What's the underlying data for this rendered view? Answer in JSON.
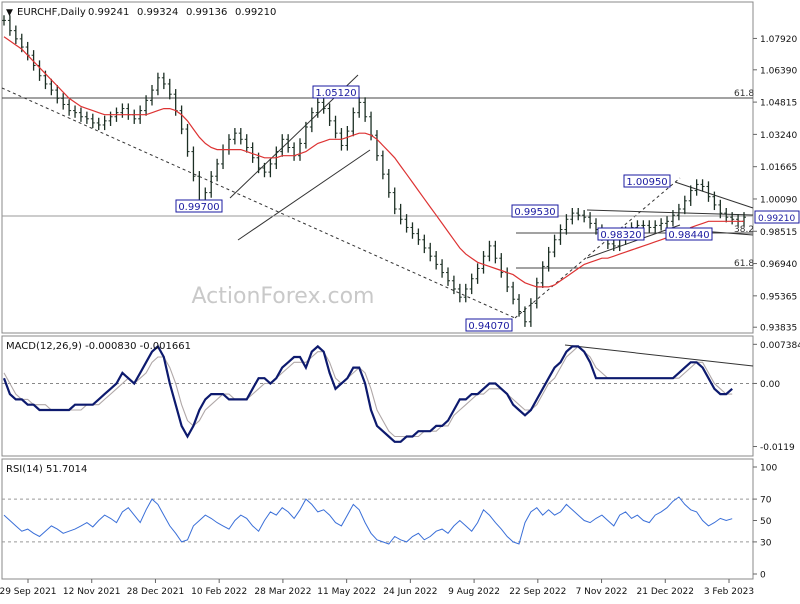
{
  "chart_data": [
    {
      "type": "line",
      "panel": "price",
      "header": {
        "arrow": "▼",
        "symbol": "EURCHF,Daily",
        "open": "0.99241",
        "high": "0.99324",
        "low": "0.99136",
        "close": "0.99210"
      },
      "watermark": "ActionForex.com",
      "ylim": [
        0.9365,
        1.096
      ],
      "y_ticks": [
        "1.07920",
        "1.06390",
        "1.04815",
        "1.03240",
        "1.01665",
        "1.00090",
        "0.98515",
        "0.96940",
        "0.95365",
        "0.93835"
      ],
      "current_price_label": "0.99210",
      "current_price": 0.9921,
      "x_labels": [
        "29 Sep 2021",
        "12 Nov 2021",
        "28 Dec 2021",
        "10 Feb 2022",
        "28 Mar 2022",
        "11 May 2022",
        "24 Jun 2022",
        "9 Aug 2022",
        "22 Sep 2022",
        "7 Nov 2022",
        "21 Dec 2022",
        "3 Feb 2023"
      ],
      "series": [
        {
          "style": "bars",
          "values": [
            1.088,
            1.083,
            1.079,
            1.075,
            1.071,
            1.066,
            1.061,
            1.057,
            1.054,
            1.05,
            1.047,
            1.044,
            1.043,
            1.041,
            1.04,
            1.038,
            1.037,
            1.039,
            1.041,
            1.043,
            1.045,
            1.042,
            1.04,
            1.044,
            1.049,
            1.054,
            1.06,
            1.057,
            1.052,
            1.044,
            1.035,
            1.024,
            1.012,
            1.0,
            1.004,
            1.012,
            1.018,
            1.025,
            1.03,
            1.033,
            1.03,
            1.026,
            1.021,
            1.016,
            1.014,
            1.018,
            1.024,
            1.03,
            1.026,
            1.022,
            1.028,
            1.036,
            1.043,
            1.048,
            1.045,
            1.039,
            1.033,
            1.027,
            1.034,
            1.043,
            1.048,
            1.041,
            1.032,
            1.022,
            1.013,
            1.004,
            0.996,
            0.991,
            0.987,
            0.984,
            0.981,
            0.977,
            0.973,
            0.969,
            0.965,
            0.961,
            0.957,
            0.953,
            0.957,
            0.962,
            0.967,
            0.973,
            0.978,
            0.972,
            0.965,
            0.958,
            0.952,
            0.946,
            0.941,
            0.95,
            0.96,
            0.968,
            0.975,
            0.981,
            0.986,
            0.991,
            0.994,
            0.993,
            0.992,
            0.989,
            0.986,
            0.983,
            0.979,
            0.978,
            0.981,
            0.985,
            0.987,
            0.988,
            0.988,
            0.987,
            0.988,
            0.989,
            0.99,
            0.993,
            0.996,
            1.0,
            1.005,
            1.008,
            1.007,
            1.002,
            0.998,
            0.994,
            0.992,
            0.991,
            0.99,
            0.992
          ]
        },
        {
          "style": "moving-average",
          "color": "#dd3333",
          "values": [
            1.08,
            1.078,
            1.076,
            1.074,
            1.071,
            1.068,
            1.065,
            1.062,
            1.059,
            1.056,
            1.053,
            1.05,
            1.048,
            1.046,
            1.045,
            1.044,
            1.043,
            1.042,
            1.042,
            1.042,
            1.042,
            1.042,
            1.042,
            1.042,
            1.042,
            1.043,
            1.044,
            1.045,
            1.045,
            1.044,
            1.042,
            1.039,
            1.035,
            1.031,
            1.028,
            1.026,
            1.025,
            1.025,
            1.025,
            1.025,
            1.025,
            1.024,
            1.023,
            1.022,
            1.021,
            1.021,
            1.021,
            1.022,
            1.022,
            1.022,
            1.023,
            1.024,
            1.026,
            1.028,
            1.029,
            1.03,
            1.03,
            1.03,
            1.031,
            1.032,
            1.033,
            1.033,
            1.032,
            1.03,
            1.027,
            1.024,
            1.021,
            1.017,
            1.013,
            1.009,
            1.005,
            1.001,
            0.997,
            0.993,
            0.989,
            0.985,
            0.981,
            0.977,
            0.974,
            0.972,
            0.97,
            0.969,
            0.968,
            0.967,
            0.966,
            0.965,
            0.964,
            0.962,
            0.96,
            0.959,
            0.958,
            0.958,
            0.958,
            0.959,
            0.961,
            0.963,
            0.965,
            0.967,
            0.969,
            0.97,
            0.971,
            0.972,
            0.972,
            0.973,
            0.974,
            0.975,
            0.976,
            0.977,
            0.978,
            0.979,
            0.98,
            0.981,
            0.982,
            0.983,
            0.984,
            0.985,
            0.987,
            0.988,
            0.989,
            0.99,
            0.99,
            0.99,
            0.99,
            0.99,
            0.99,
            0.99
          ]
        }
      ],
      "annotations": [
        {
          "label": "1.05120",
          "value": 1.0512
        },
        {
          "label": "0.99700",
          "value": 0.997
        },
        {
          "label": "0.99530",
          "value": 0.9953
        },
        {
          "label": "1.00950",
          "value": 1.0095
        },
        {
          "label": "0.98320",
          "value": 0.9832
        },
        {
          "label": "0.98440",
          "value": 0.9844
        },
        {
          "label": "0.94070",
          "value": 0.9407
        },
        {
          "label": "61.8",
          "value": 1.049
        },
        {
          "label": "61.8",
          "value": 0.969
        },
        {
          "label": "38.2",
          "value": 0.985
        }
      ]
    },
    {
      "type": "line",
      "panel": "macd",
      "title": "MACD(12,26,9) -0.000830 -0.001661",
      "ylim": [
        -0.0135,
        0.0082
      ],
      "y_ticks": [
        "0.007384",
        "0.00",
        "-0.0119"
      ],
      "series": [
        {
          "name": "MACD",
          "color": "#0d1a6e",
          "values": [
            0.001,
            -0.002,
            -0.003,
            -0.003,
            -0.004,
            -0.004,
            -0.005,
            -0.005,
            -0.005,
            -0.005,
            -0.005,
            -0.005,
            -0.004,
            -0.004,
            -0.004,
            -0.004,
            -0.003,
            -0.002,
            -0.001,
            0.0,
            0.002,
            0.001,
            0.0,
            0.002,
            0.004,
            0.006,
            0.007,
            0.005,
            0.0,
            -0.004,
            -0.008,
            -0.01,
            -0.008,
            -0.005,
            -0.003,
            -0.002,
            -0.002,
            -0.002,
            -0.003,
            -0.003,
            -0.003,
            -0.003,
            -0.001,
            0.001,
            0.001,
            0.0,
            0.001,
            0.003,
            0.004,
            0.005,
            0.005,
            0.003,
            0.006,
            0.007,
            0.006,
            0.002,
            -0.001,
            0.0,
            0.001,
            0.003,
            0.003,
            0.0,
            -0.005,
            -0.008,
            -0.009,
            -0.01,
            -0.011,
            -0.011,
            -0.01,
            -0.01,
            -0.009,
            -0.009,
            -0.009,
            -0.008,
            -0.008,
            -0.007,
            -0.005,
            -0.003,
            -0.003,
            -0.002,
            -0.002,
            -0.001,
            0.0,
            0.0,
            -0.001,
            -0.002,
            -0.004,
            -0.005,
            -0.006,
            -0.005,
            -0.003,
            -0.001,
            0.001,
            0.003,
            0.004,
            0.006,
            0.007,
            0.007,
            0.006,
            0.004,
            0.001,
            0.001,
            0.001,
            0.001,
            0.001,
            0.001,
            0.001,
            0.001,
            0.001,
            0.001,
            0.001,
            0.001,
            0.001,
            0.001,
            0.002,
            0.003,
            0.004,
            0.004,
            0.003,
            0.001,
            -0.001,
            -0.002,
            -0.002,
            -0.001
          ]
        },
        {
          "name": "Signal",
          "color": "#b0a8a8",
          "values": [
            0.002,
            0.0,
            -0.002,
            -0.003,
            -0.003,
            -0.004,
            -0.004,
            -0.004,
            -0.005,
            -0.005,
            -0.005,
            -0.005,
            -0.005,
            -0.005,
            -0.004,
            -0.004,
            -0.004,
            -0.003,
            -0.002,
            -0.001,
            0.0,
            0.001,
            0.0,
            0.001,
            0.002,
            0.004,
            0.005,
            0.005,
            0.003,
            0.0,
            -0.004,
            -0.007,
            -0.008,
            -0.007,
            -0.005,
            -0.004,
            -0.003,
            -0.002,
            -0.002,
            -0.003,
            -0.003,
            -0.003,
            -0.002,
            -0.001,
            0.0,
            0.0,
            0.001,
            0.002,
            0.003,
            0.004,
            0.004,
            0.004,
            0.005,
            0.006,
            0.006,
            0.004,
            0.001,
            0.0,
            0.001,
            0.002,
            0.003,
            0.002,
            -0.001,
            -0.005,
            -0.007,
            -0.009,
            -0.01,
            -0.01,
            -0.01,
            -0.01,
            -0.01,
            -0.009,
            -0.009,
            -0.009,
            -0.008,
            -0.008,
            -0.006,
            -0.005,
            -0.004,
            -0.003,
            -0.002,
            -0.002,
            -0.001,
            -0.001,
            -0.001,
            -0.002,
            -0.003,
            -0.004,
            -0.005,
            -0.005,
            -0.004,
            -0.002,
            0.0,
            0.001,
            0.003,
            0.005,
            0.006,
            0.007,
            0.006,
            0.005,
            0.003,
            0.002,
            0.001,
            0.001,
            0.001,
            0.001,
            0.001,
            0.001,
            0.001,
            0.001,
            0.001,
            0.001,
            0.001,
            0.001,
            0.001,
            0.002,
            0.003,
            0.004,
            0.004,
            0.002,
            0.0,
            -0.001,
            -0.002,
            -0.002
          ]
        }
      ]
    },
    {
      "type": "line",
      "panel": "rsi",
      "title": "RSI(14) 51.7014",
      "ylim": [
        0,
        100
      ],
      "y_ticks": [
        "100",
        "70",
        "50",
        "30",
        "0"
      ],
      "levels": [
        70,
        30
      ],
      "series": [
        {
          "name": "RSI",
          "color": "#3a6fd8",
          "values": [
            55,
            50,
            45,
            40,
            42,
            38,
            35,
            40,
            45,
            42,
            38,
            40,
            42,
            45,
            48,
            44,
            50,
            55,
            52,
            48,
            58,
            62,
            55,
            48,
            60,
            70,
            65,
            55,
            45,
            38,
            30,
            32,
            45,
            50,
            55,
            52,
            48,
            45,
            42,
            50,
            55,
            52,
            45,
            40,
            50,
            58,
            55,
            62,
            58,
            52,
            60,
            70,
            65,
            58,
            60,
            55,
            48,
            45,
            55,
            65,
            60,
            48,
            38,
            32,
            30,
            28,
            35,
            32,
            30,
            35,
            38,
            32,
            35,
            40,
            42,
            38,
            45,
            50,
            45,
            40,
            48,
            60,
            55,
            48,
            42,
            35,
            30,
            28,
            48,
            58,
            62,
            55,
            60,
            55,
            58,
            65,
            60,
            55,
            50,
            48,
            52,
            55,
            50,
            45,
            55,
            58,
            52,
            55,
            50,
            48,
            55,
            58,
            62,
            68,
            72,
            65,
            60,
            58,
            50,
            45,
            48,
            52,
            50,
            51.7
          ]
        }
      ]
    }
  ]
}
